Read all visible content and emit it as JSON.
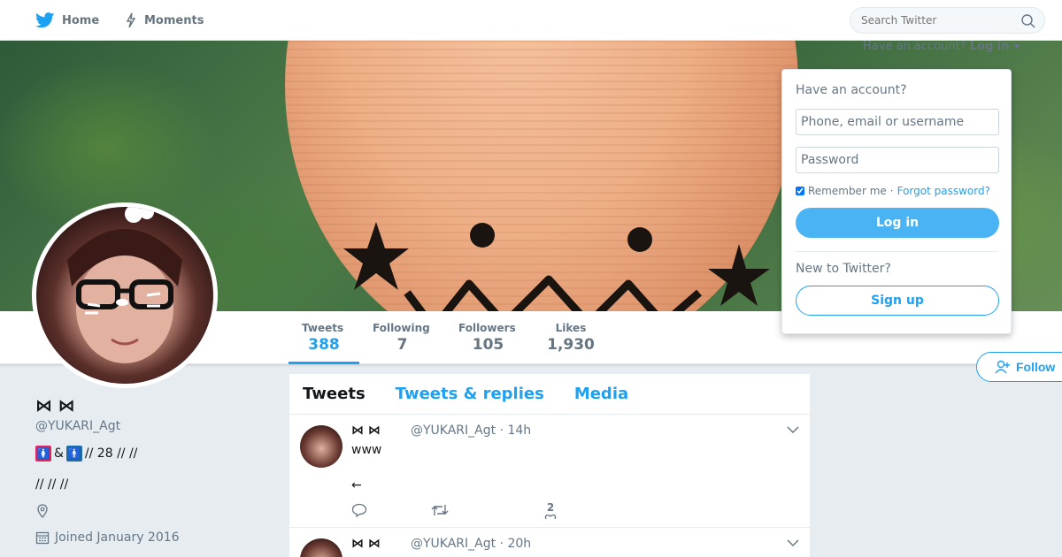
{
  "nav": {
    "home": "Home",
    "moments": "Moments",
    "search_placeholder": "Search Twitter"
  },
  "account": {
    "prompt": "Have an account?",
    "login_label": "Log in"
  },
  "login_dropdown": {
    "title": "Have an account?",
    "username_placeholder": "Phone, email or username",
    "password_placeholder": "Password",
    "remember_label": "Remember me",
    "separator": "·",
    "forgot_label": "Forgot password?",
    "login_button": "Log in",
    "new_prompt": "New to Twitter?",
    "signup_button": "Sign up"
  },
  "stats": [
    {
      "label": "Tweets",
      "value": "388"
    },
    {
      "label": "Following",
      "value": "7"
    },
    {
      "label": "Followers",
      "value": "105"
    },
    {
      "label": "Likes",
      "value": "1,930"
    }
  ],
  "follow_label": "Follow",
  "profile": {
    "name": "⋈ ⋈",
    "handle": "@YUKARI_Agt",
    "bio_emoji_1": "🚺",
    "bio_amp": "&",
    "bio_emoji_2": "🚹",
    "bio_rest": " // 28 //  //",
    "bio_line2": "//  //  //",
    "joined": "Joined January 2016"
  },
  "timeline": {
    "tabs": [
      "Tweets",
      "Tweets & replies",
      "Media"
    ],
    "tweets": [
      {
        "name": "⋈  ⋈",
        "handle_time": "@YUKARI_Agt · 14h",
        "text": "www\n\n←",
        "likes": "2"
      },
      {
        "name": "⋈  ⋈",
        "handle_time": "@YUKARI_Agt · 20h",
        "text": "",
        "likes": ""
      }
    ]
  },
  "colors": {
    "accent": "#1da1f2",
    "background": "#e6ecf0"
  }
}
